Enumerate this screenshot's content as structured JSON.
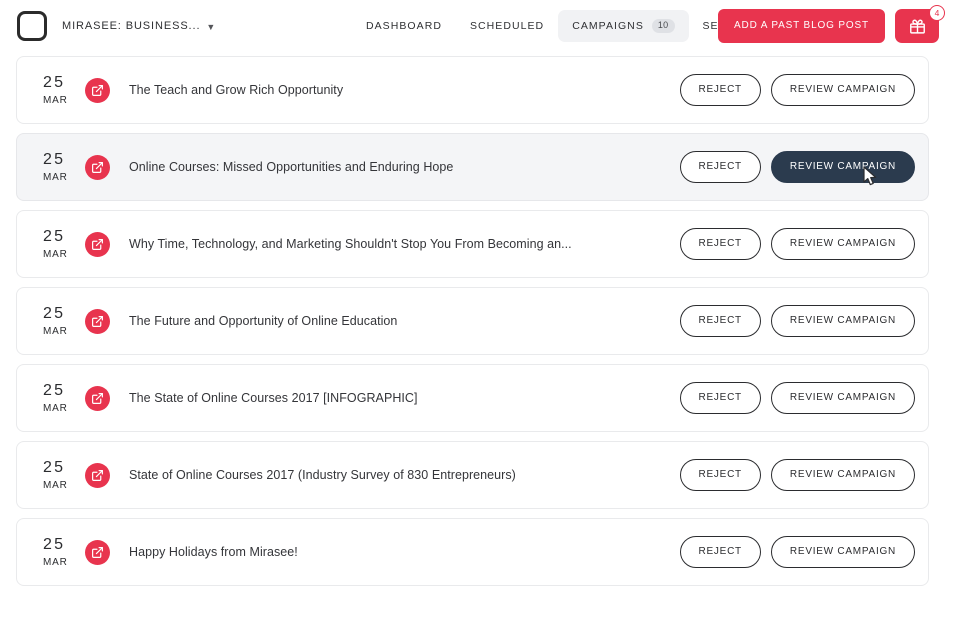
{
  "header": {
    "logo_icon": "rounded-square-logo",
    "brand_label": "MIRASEE: BUSINESS...",
    "brand_chevron_icon": "chevron-down-icon",
    "nav": [
      {
        "label": "DASHBOARD",
        "active": false,
        "badge": null
      },
      {
        "label": "SCHEDULED",
        "active": false,
        "badge": null
      },
      {
        "label": "CAMPAIGNS",
        "active": true,
        "badge": "10"
      },
      {
        "label": "SETTINGS",
        "active": false,
        "badge": null
      }
    ],
    "add_post_label": "ADD A PAST BLOG POST",
    "gift_icon": "gift-icon",
    "gift_badge": "4"
  },
  "colors": {
    "brand_red": "#e8344e",
    "hover_dark": "#2b3b4e",
    "row_hover_bg": "#f4f5f7",
    "border": "#e9eaec"
  },
  "buttons": {
    "reject_label": "REJECT",
    "review_label": "REVIEW CAMPAIGN"
  },
  "campaigns": [
    {
      "day": "25",
      "month": "MAR",
      "icon": "external-link-icon",
      "title": "The Teach and Grow Rich Opportunity",
      "hovered": false
    },
    {
      "day": "25",
      "month": "MAR",
      "icon": "external-link-icon",
      "title": "Online Courses: Missed Opportunities and Enduring Hope",
      "hovered": true
    },
    {
      "day": "25",
      "month": "MAR",
      "icon": "external-link-icon",
      "title": "Why Time, Technology, and Marketing Shouldn't Stop You From Becoming an...",
      "hovered": false
    },
    {
      "day": "25",
      "month": "MAR",
      "icon": "external-link-icon",
      "title": "The Future and Opportunity of Online Education",
      "hovered": false
    },
    {
      "day": "25",
      "month": "MAR",
      "icon": "external-link-icon",
      "title": "The State of Online Courses 2017 [INFOGRAPHIC]",
      "hovered": false
    },
    {
      "day": "25",
      "month": "MAR",
      "icon": "external-link-icon",
      "title": "State of Online Courses 2017 (Industry Survey of 830 Entrepreneurs)",
      "hovered": false
    },
    {
      "day": "25",
      "month": "MAR",
      "icon": "external-link-icon",
      "title": "Happy Holidays from Mirasee!",
      "hovered": false
    }
  ]
}
